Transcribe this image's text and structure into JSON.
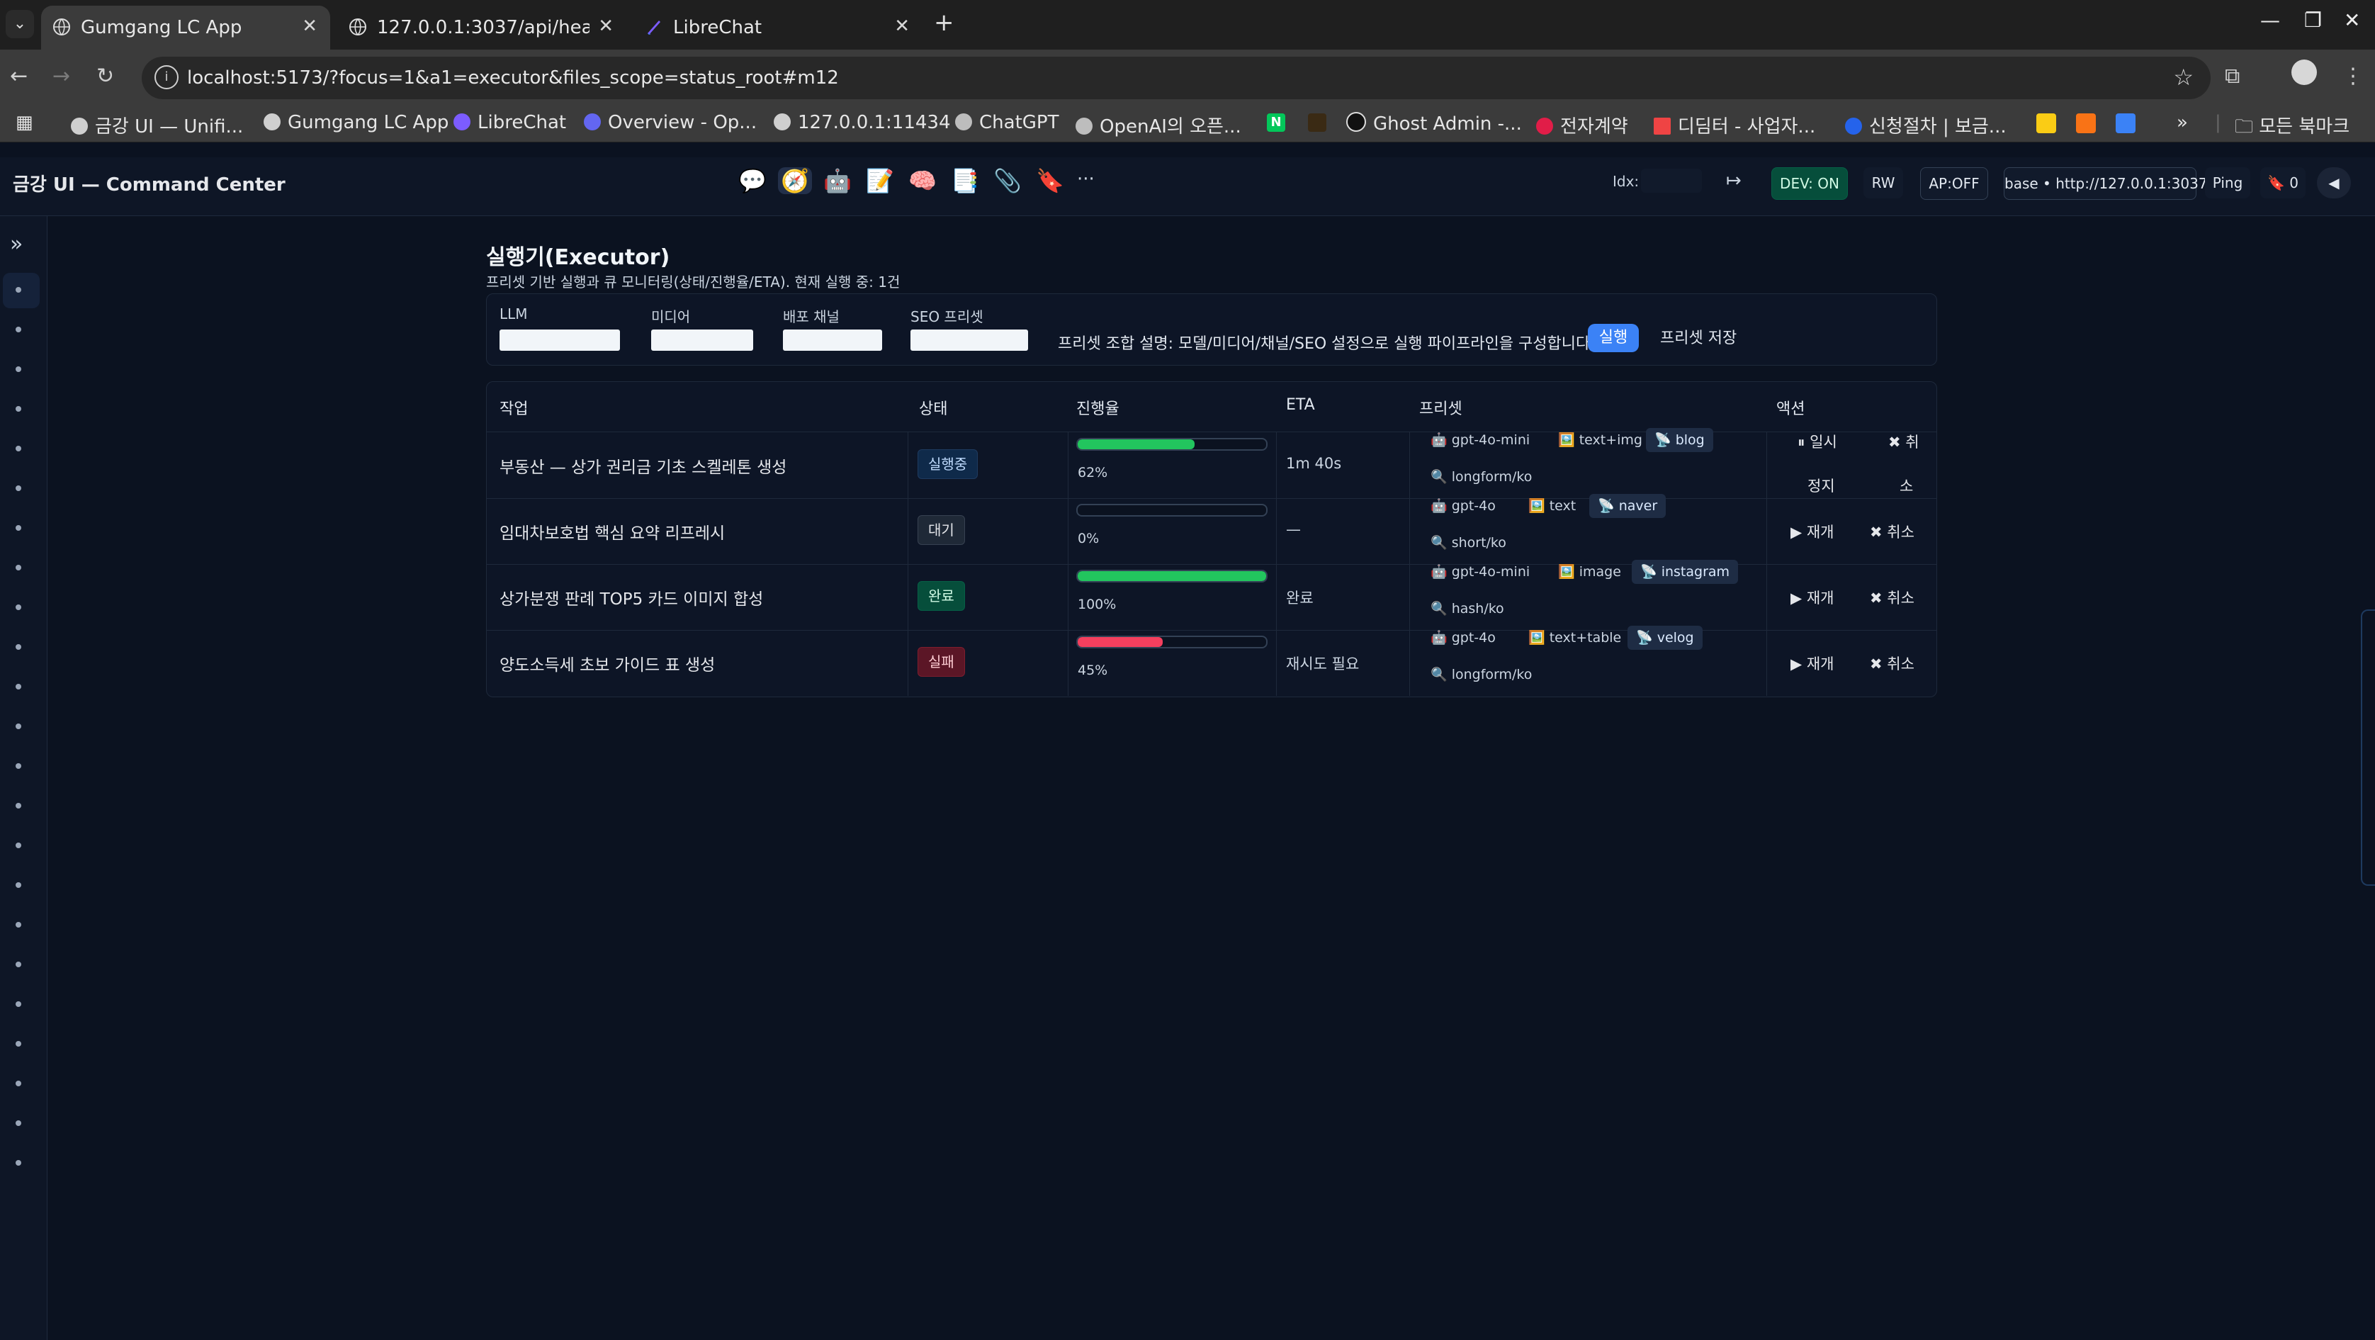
{
  "browser": {
    "tabs": [
      {
        "title": "Gumgang LC App",
        "active": true
      },
      {
        "title": "127.0.0.1:3037/api/healt",
        "active": false
      },
      {
        "title": "LibreChat",
        "active": false
      }
    ],
    "url": "localhost:5173/?focus=1&a1=executor&files_scope=status_root#m12",
    "bookmarks": [
      "금강 UI — Unifi...",
      "Gumgang LC App",
      "LibreChat",
      "Overview - Op...",
      "127.0.0.1:11434",
      "ChatGPT",
      "OpenAI의 오픈...",
      "Ghost Admin -...",
      "전자계약",
      "디딤터 - 사업자...",
      "신청절차 | 보금...",
      "모든 북마크"
    ],
    "bookmark_badges": {
      "n": "N",
      "more": "»"
    }
  },
  "header": {
    "title": "금강 UI — Command Center",
    "icons": [
      "chat-icon",
      "compass-icon",
      "robot-icon",
      "memo-icon",
      "brain-icon",
      "document-icon",
      "paperclip-icon",
      "bookmark-icon",
      "more-icon"
    ],
    "icon_glyphs": [
      "💬",
      "🧭",
      "🤖",
      "📝",
      "🧠",
      "📑",
      "📎",
      "🔖",
      "···"
    ],
    "idx_label": "Idx:",
    "arrow": "↦",
    "dev": "DEV: ON",
    "rw": "RW",
    "ap": "AP:OFF",
    "base": "base • http://127.0.0.1:3037",
    "ping": "Ping",
    "bookmark_count": "🔖 0",
    "collapse": "◀"
  },
  "rail": {
    "toggle": "»"
  },
  "executor": {
    "title": "실행기(Executor)",
    "subtitle": "프리셋 기반 실행과 큐 모니터링(상태/진행율/ETA). 현재 실행 중: 1건",
    "preset_labels": {
      "llm": "LLM",
      "media": "미디어",
      "channel": "배포 채널",
      "seo": "SEO 프리셋"
    },
    "preset_desc": "프리셋 조합 설명: 모델/미디어/채널/SEO 설정으로 실행 파이프라인을 구성합니다.",
    "run_button": "실행",
    "save_button": "프리셋 저장",
    "columns": [
      "작업",
      "상태",
      "진행율",
      "ETA",
      "프리셋",
      "액션"
    ],
    "rows": [
      {
        "task": "부동산 — 상가 권리금 기초 스켈레톤 생성",
        "status": "실행중",
        "status_kind": "run",
        "progress": 62,
        "progress_label": "62%",
        "progress_color": "#22c55e",
        "eta": "1m 40s",
        "llm": "🤖 gpt-4o-mini",
        "media": "🖼️ text+img",
        "channel": "📡 blog",
        "seo": "🔍 longform/ko",
        "action1": "⏸ 일시",
        "action1b": "정지",
        "action2": "✖ 취",
        "action2b": "소"
      },
      {
        "task": "임대차보호법 핵심 요약 리프레시",
        "status": "대기",
        "status_kind": "wait",
        "progress": 0,
        "progress_label": "0%",
        "progress_color": "#22c55e",
        "eta": "—",
        "llm": "🤖 gpt-4o",
        "media": "🖼️ text",
        "channel": "📡 naver",
        "seo": "🔍 short/ko",
        "action1": "▶ 재개",
        "action2": "✖ 취소"
      },
      {
        "task": "상가분쟁 판례 TOP5 카드 이미지 합성",
        "status": "완료",
        "status_kind": "done",
        "progress": 100,
        "progress_label": "100%",
        "progress_color": "#22c55e",
        "eta": "완료",
        "llm": "🤖 gpt-4o-mini",
        "media": "🖼️ image",
        "channel": "📡 instagram",
        "seo": "🔍 hash/ko",
        "action1": "▶ 재개",
        "action2": "✖ 취소"
      },
      {
        "task": "양도소득세 초보 가이드 표 생성",
        "status": "실패",
        "status_kind": "fail",
        "progress": 45,
        "progress_label": "45%",
        "progress_color": "#f43f5e",
        "eta": "재시도 필요",
        "llm": "🤖 gpt-4o",
        "media": "🖼️ text+table",
        "channel": "📡 velog",
        "seo": "🔍 longform/ko",
        "action1": "▶ 재개",
        "action2": "✖ 취소"
      }
    ]
  }
}
